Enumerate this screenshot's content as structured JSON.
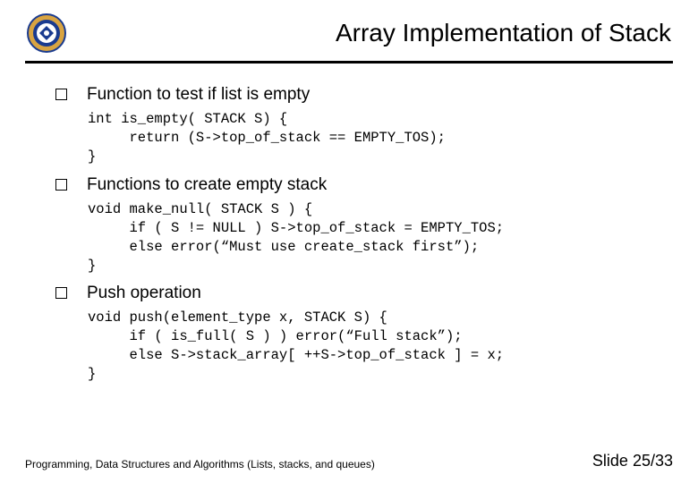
{
  "title": "Array Implementation of Stack",
  "bullets": [
    {
      "text": "Function to test if list is empty",
      "code": "int is_empty( STACK S) {\n     return (S->top_of_stack == EMPTY_TOS);\n}"
    },
    {
      "text": "Functions to create empty stack",
      "code": "void make_null( STACK S ) {\n     if ( S != NULL ) S->top_of_stack = EMPTY_TOS;\n     else error(“Must use create_stack first”);\n}"
    },
    {
      "text": "Push operation",
      "code": "void push(element_type x, STACK S) {\n     if ( is_full( S ) ) error(“Full stack”);\n     else S->stack_array[ ++S->top_of_stack ] = x;\n}"
    }
  ],
  "footer": {
    "left": "Programming, Data Structures and Algorithms  (Lists, stacks, and queues)",
    "right": "Slide 25/33"
  }
}
